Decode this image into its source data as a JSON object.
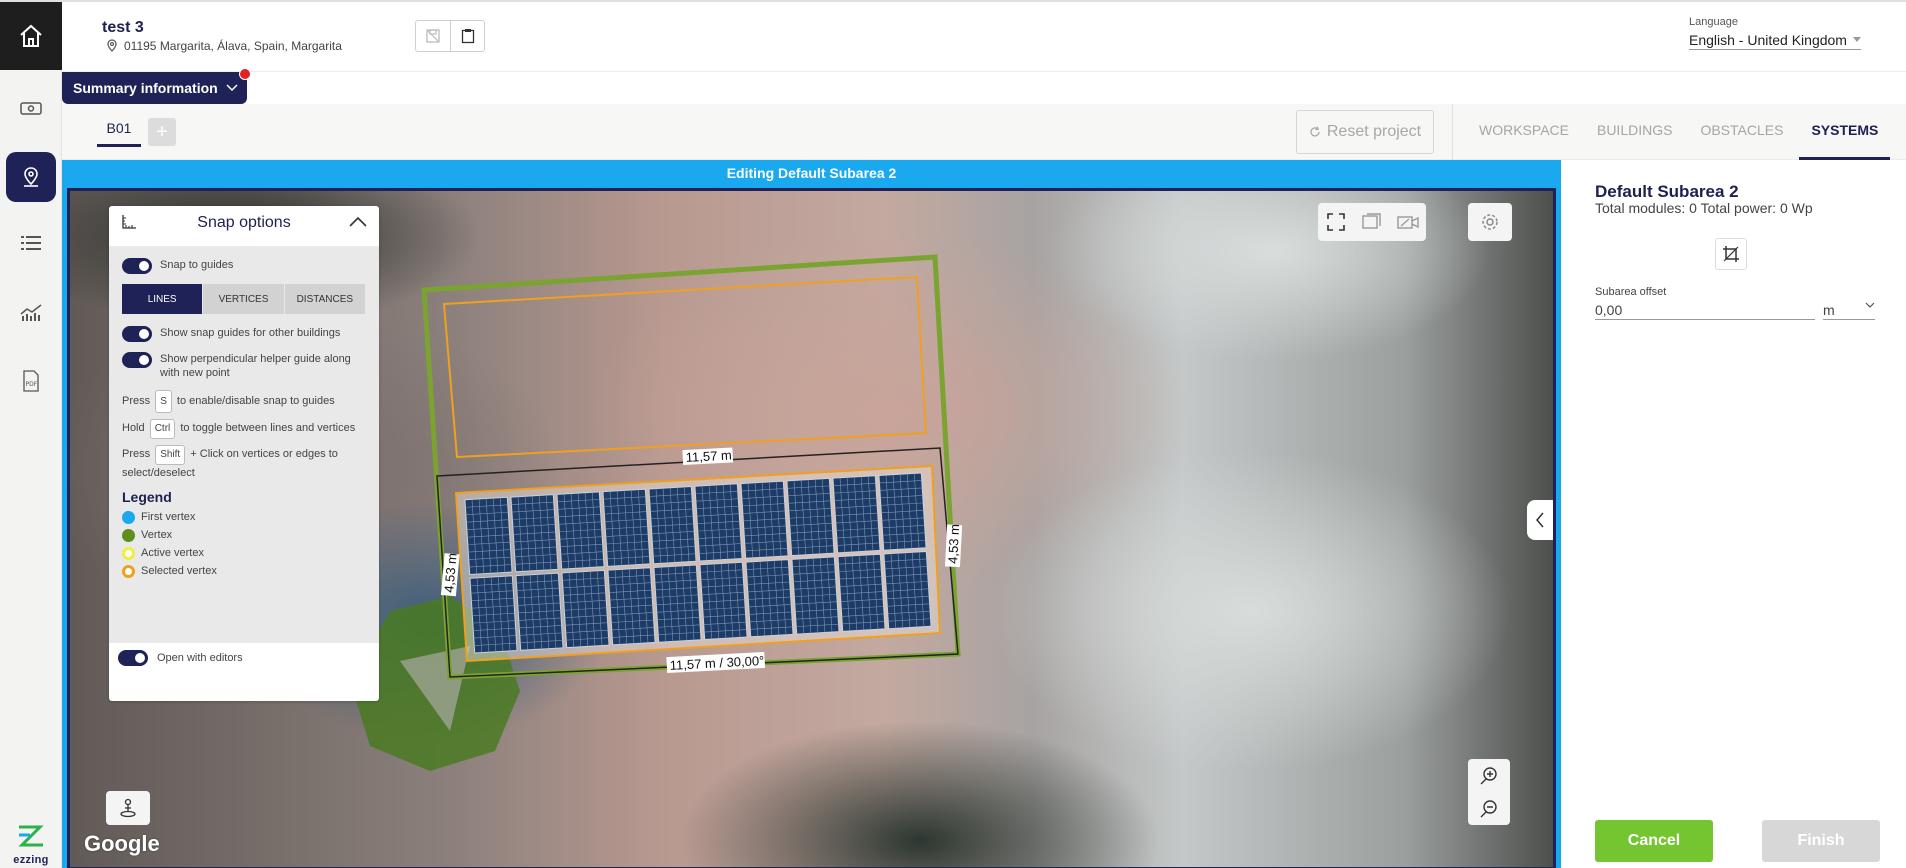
{
  "project": {
    "title": "test 3",
    "address": "01195 Margarita, Álava, Spain, Margarita"
  },
  "language": {
    "label": "Language",
    "value": "English - United Kingdom"
  },
  "summary": {
    "label": "Summary information"
  },
  "sidebar": {
    "items": [
      "home-icon",
      "roof-design-icon",
      "location-icon",
      "list-icon",
      "chart-icon",
      "pdf-icon"
    ],
    "logo_text": "ezzing"
  },
  "toolbar": {
    "building_tab": "B01",
    "add_label": "+",
    "reset_label": "Reset project",
    "tabs": [
      {
        "label": "WORKSPACE",
        "active": false
      },
      {
        "label": "BUILDINGS",
        "active": false
      },
      {
        "label": "OBSTACLES",
        "active": false
      },
      {
        "label": "SYSTEMS",
        "active": true
      }
    ]
  },
  "map": {
    "editing_label": "Editing Default Subarea 2",
    "google_label": "Google",
    "dimension_top": "11,57 m",
    "dimension_bottom": "11,57 m / 30,00°",
    "dimension_left": "4,53 m",
    "dimension_right": "4,53 m",
    "panel_rows": 2,
    "panel_cols": 10,
    "colors": {
      "accent": "#1aa9ef",
      "roof_outline": "#7aa331",
      "subarea_outline": "#f0a020",
      "panel": "#1c3b67"
    }
  },
  "snap_panel": {
    "title": "Snap options",
    "snap_to_guides": "Snap to guides",
    "modes": [
      {
        "label": "LINES",
        "active": true
      },
      {
        "label": "VERTICES",
        "active": false
      },
      {
        "label": "DISTANCES",
        "active": false
      }
    ],
    "other_buildings": "Show snap guides for other buildings",
    "perpendicular": "Show perpendicular helper guide along with new point",
    "hint1_pre": "Press",
    "hint1_key": "S",
    "hint1_post": "to enable/disable snap to guides",
    "hint2_pre": "Hold",
    "hint2_key": "Ctrl",
    "hint2_post": "to toggle between lines and vertices",
    "hint3_pre": "Press",
    "hint3_key": "Shift",
    "hint3_post": "+ Click on vertices or edges to select/deselect",
    "legend_title": "Legend",
    "legend": [
      {
        "label": "First vertex",
        "color": "#1aa9ef"
      },
      {
        "label": "Vertex",
        "color": "#5e8f1c"
      },
      {
        "label": "Active vertex",
        "color": "#f2ef3a"
      },
      {
        "label": "Selected vertex",
        "color": "#f0a020"
      }
    ],
    "open_with_editors": "Open with editors"
  },
  "right_panel": {
    "title": "Default Subarea 2",
    "subtitle": "Total modules: 0 Total power: 0 Wp",
    "offset_label": "Subarea offset",
    "offset_value": "0,00",
    "offset_unit": "m",
    "cancel_label": "Cancel",
    "finish_label": "Finish"
  }
}
